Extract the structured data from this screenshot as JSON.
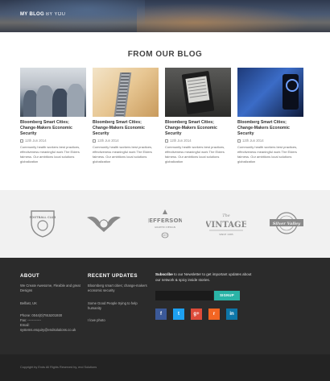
{
  "header": {
    "brand_bold": "MY BLOG",
    "brand_light": "BY YOU"
  },
  "blog": {
    "title": "FROM OUR BLOG",
    "posts": [
      {
        "title": "Bloomberg Smart Cities; Change-Makers Economic Security",
        "date": "12th Jun 2014",
        "excerpt": "Community health workers best practices, effectiveness meaningful work The Elders fairness. Our ambitions local solutions globalization"
      },
      {
        "title": "Bloomberg Smart Cities; Change-Makers Economic Security",
        "date": "12th Jun 2014",
        "excerpt": "Community health workers best practices, effectiveness meaningful work The Elders fairness. Our ambitions local solutions globalization"
      },
      {
        "title": "Bloomberg Smart Cities; Change-Makers Economic Security",
        "date": "12th Jun 2014",
        "excerpt": "Community health workers best practices, effectiveness meaningful work The Elders fairness. Our ambitions local solutions globalization"
      },
      {
        "title": "Bloomberg Smart Cities; Change-Makers Economic Security",
        "date": "12th Jun 2014",
        "excerpt": "Community health workers best practices, effectiveness meaningful work The Elders fairness. Our ambitions local solutions globalization"
      }
    ]
  },
  "logos": {
    "items": [
      {
        "name": "football-club-logo",
        "text": "FOOTBALL CLUB"
      },
      {
        "name": "eagle-emblem-logo",
        "text": ""
      },
      {
        "name": "jefferson-logo",
        "text": "JEFFERSON",
        "sub": "GRAPHIC DESIGN",
        "year": "1873"
      },
      {
        "name": "vintage-logo",
        "text": "VINTAGE",
        "pre": "The",
        "sub": "SINCE 1985"
      },
      {
        "name": "silver-valley-logo",
        "text": "Silver Valley"
      }
    ]
  },
  "footer": {
    "about": {
      "heading": "ABOUT",
      "line1": "We Create Awesome, Flexible and great Designs",
      "location": "Belfast, UK",
      "phone": "Phone: 0044(0)7915201930",
      "fax": "Fax: ------------",
      "email_label": "Email:",
      "email": "systems.enquiry@endsolutions.co.uk"
    },
    "updates": {
      "heading": "RECENT UPDATES",
      "items": [
        "Bloomberg smart cities; change-makers economic security",
        "Some Good People trying to help humanity",
        "I love photo"
      ]
    },
    "newsletter": {
      "text_bold": "Subscribe",
      "text_rest": "to our Newsletter to get important updates about our network & spicy inside stories.",
      "placeholder": "",
      "button": "SIGNUP"
    },
    "social": [
      {
        "icon": "facebook-icon",
        "glyph": "f",
        "color": "#3b5998"
      },
      {
        "icon": "twitter-icon",
        "glyph": "t",
        "color": "#1da1f2"
      },
      {
        "icon": "google-plus-icon",
        "glyph": "g+",
        "color": "#dd4b39"
      },
      {
        "icon": "rss-icon",
        "glyph": "r",
        "color": "#f26522"
      },
      {
        "icon": "linkedin-icon",
        "glyph": "in",
        "color": "#0e76a8"
      }
    ],
    "copyright": "Copyright by Ends All Rights Reserved by, end Solutions"
  }
}
